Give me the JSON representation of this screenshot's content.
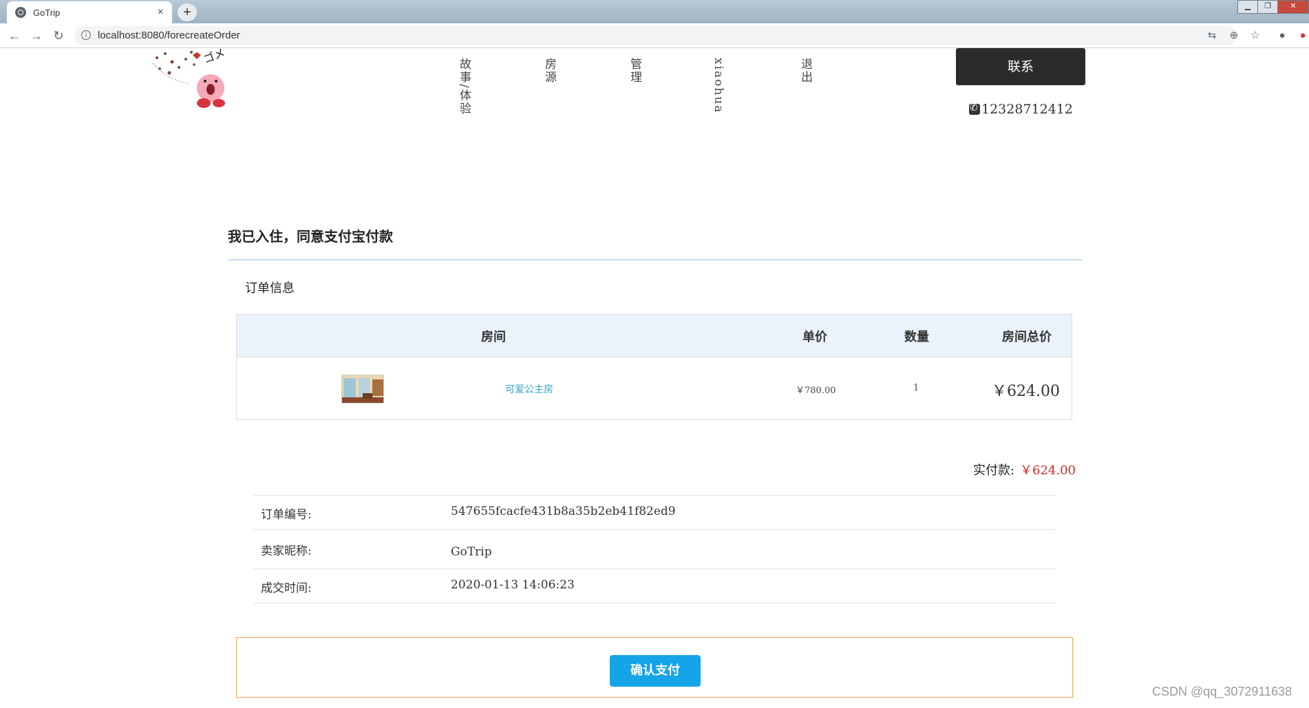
{
  "browser": {
    "tab_title": "GoTrip",
    "tab_close": "×",
    "new_tab": "+",
    "url": "localhost:8080/forecreateOrder",
    "window_controls": [
      "▁",
      "❐",
      "✕"
    ]
  },
  "header": {
    "nav_items": [
      "故事/体验",
      "房源",
      "管理",
      "xiaohua",
      "退出"
    ],
    "contact_label": "联系",
    "phone": "12328712412"
  },
  "main": {
    "heading": "我已入住，同意支付宝付款",
    "section_title": "订单信息",
    "table": {
      "headers": [
        "房间",
        "单价",
        "数量",
        "房间总价"
      ],
      "rows": [
        {
          "room_name": "可爱公主房",
          "unit_price": "￥780.00",
          "quantity": "1",
          "total_price": "￥624.00"
        }
      ]
    },
    "paid_label": "实付款:",
    "paid_amount": "￥624.00",
    "info": [
      {
        "label": "订单编号:",
        "value": "547655fcacfe431b8a35b2eb41f82ed9"
      },
      {
        "label": "卖家昵称:",
        "value": "GoTrip"
      },
      {
        "label": "成交时间:",
        "value": "2020-01-13 14:06:23"
      }
    ],
    "confirm_button": "确认支付"
  },
  "watermark": "CSDN @qq_3072911638",
  "colors": {
    "accent_blue": "#15a4e8",
    "price_red": "#d22a2a",
    "link_teal": "#2aa3c8",
    "box_orange": "#f0a34a",
    "dark_button": "#2b2b2b"
  }
}
